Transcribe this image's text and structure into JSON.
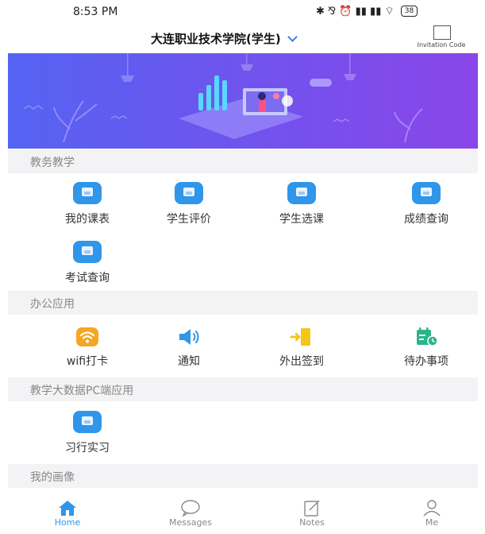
{
  "status": {
    "time": "8:53 PM",
    "icons_text": "✱ ⅋ ⏰ ▮▮ ▮▮ ⌔",
    "battery": "38"
  },
  "header": {
    "school": "大连职业技术学院(学生)",
    "invite_label": "Invitation Code"
  },
  "sections": {
    "academic": {
      "title": "教务教学",
      "items": [
        {
          "label": "我的课表",
          "icon": "image-placeholder-icon"
        },
        {
          "label": "学生评价",
          "icon": "image-placeholder-icon"
        },
        {
          "label": "学生选课",
          "icon": "image-placeholder-icon"
        },
        {
          "label": "成绩查询",
          "icon": "image-placeholder-icon"
        },
        {
          "label": "考试查询",
          "icon": "image-placeholder-icon"
        }
      ]
    },
    "office": {
      "title": "办公应用",
      "items": [
        {
          "label": "wifi打卡",
          "icon": "wifi-icon",
          "color": "#f5a623"
        },
        {
          "label": "通知",
          "icon": "speaker-icon",
          "color": "#2f96ea"
        },
        {
          "label": "外出签到",
          "icon": "exit-door-icon",
          "color": "#f5c518"
        },
        {
          "label": "待办事项",
          "icon": "calendar-todo-icon",
          "color": "#2bb48a"
        }
      ]
    },
    "bigdata": {
      "title": "教学大数据PC端应用",
      "items": [
        {
          "label": "习行实习",
          "icon": "image-placeholder-icon"
        }
      ]
    },
    "portrait": {
      "title": "我的画像"
    }
  },
  "tabs": [
    {
      "label": "Home",
      "icon": "home-icon",
      "active": true
    },
    {
      "label": "Messages",
      "icon": "chat-bubble-icon",
      "active": false
    },
    {
      "label": "Notes",
      "icon": "note-edit-icon",
      "active": false
    },
    {
      "label": "Me",
      "icon": "person-icon",
      "active": false
    }
  ],
  "colors": {
    "accent": "#2f96ea",
    "banner_start": "#5563f2",
    "banner_end": "#8a46e8",
    "section_bg": "#f3f3f5"
  }
}
